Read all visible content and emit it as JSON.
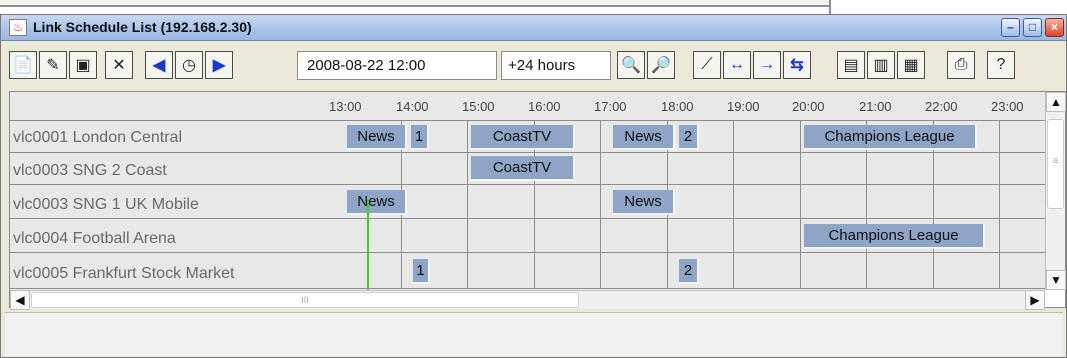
{
  "window": {
    "title": "Link Schedule List (192.168.2.30)",
    "controls": [
      "minimize",
      "maximize",
      "close"
    ]
  },
  "toolbar": {
    "date_value": "2008-08-22 12:00",
    "range_value": "+24 hours",
    "icons": [
      "new-icon",
      "edit-icon",
      "properties-icon",
      "delete-icon",
      "previous-icon",
      "clock-icon",
      "next-icon",
      "zoom-in-icon",
      "zoom-out-icon",
      "chart-icon",
      "link-icon",
      "connect-icon",
      "network-icon",
      "report-icon",
      "export-icon",
      "import-icon",
      "print-icon",
      "help-icon"
    ]
  },
  "timeline": {
    "ticks": [
      "13:00",
      "14:00",
      "15:00",
      "16:00",
      "17:00",
      "18:00",
      "19:00",
      "20:00",
      "21:00",
      "22:00",
      "23:00"
    ]
  },
  "rows": [
    {
      "label": "vlc0001 London Central"
    },
    {
      "label": "vlc0003 SNG 2 Coast"
    },
    {
      "label": "vlc0003 SNG 1 UK Mobile"
    },
    {
      "label": "vlc0004 Football Arena"
    },
    {
      "label": "vlc0005 Frankfurt Stock Market"
    }
  ],
  "events": [
    {
      "row": 0,
      "label": "News"
    },
    {
      "row": 0,
      "label": "1"
    },
    {
      "row": 0,
      "label": "CoastTV"
    },
    {
      "row": 0,
      "label": "News"
    },
    {
      "row": 0,
      "label": "2"
    },
    {
      "row": 0,
      "label": "Champions League"
    },
    {
      "row": 1,
      "label": "CoastTV"
    },
    {
      "row": 2,
      "label": "News"
    },
    {
      "row": 2,
      "label": "News"
    },
    {
      "row": 3,
      "label": "Champions League"
    },
    {
      "row": 4,
      "label": "1"
    },
    {
      "row": 4,
      "label": "2"
    }
  ],
  "colors": {
    "event": "#8ea5c8",
    "now_line": "#3bd11d",
    "grid_background": "#e8e8e8"
  }
}
